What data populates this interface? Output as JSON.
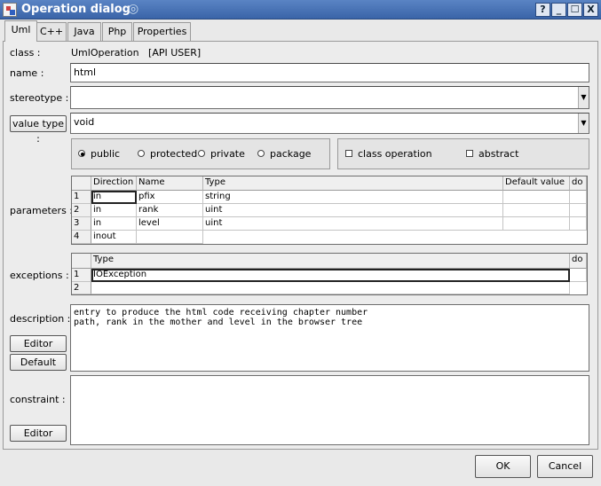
{
  "window": {
    "title": "Operation dialog",
    "help": "?",
    "minimize": "_",
    "maximize": "☐",
    "close": "X"
  },
  "tabs": [
    "Uml",
    "C++",
    "Java",
    "Php",
    "Properties"
  ],
  "class_row": {
    "label": "class :",
    "value": "UmlOperation   [API USER]"
  },
  "name_row": {
    "label": "name :",
    "value": "html"
  },
  "stereotype_row": {
    "label": "stereotype :",
    "value": ""
  },
  "value_type_row": {
    "button": "value type :",
    "value": "void"
  },
  "visibility": {
    "options": [
      "public",
      "protected",
      "private",
      "package"
    ],
    "selected": "public"
  },
  "flags": {
    "class_operation": "class operation",
    "abstract": "abstract",
    "class_operation_checked": false,
    "abstract_checked": false
  },
  "parameters": {
    "label": "parameters :",
    "columns": [
      "Direction",
      "Name",
      "Type",
      "Default value",
      "do"
    ],
    "rows": [
      {
        "num": "1",
        "direction": "in",
        "name": "pfix",
        "type": "string",
        "default": "",
        "do": ""
      },
      {
        "num": "2",
        "direction": "in",
        "name": "rank",
        "type": "uint",
        "default": "",
        "do": ""
      },
      {
        "num": "3",
        "direction": "in",
        "name": "level",
        "type": "uint",
        "default": "",
        "do": ""
      },
      {
        "num": "4",
        "direction": "inout",
        "name": "",
        "type": "",
        "default": "",
        "do": ""
      }
    ]
  },
  "exceptions": {
    "label": "exceptions :",
    "columns": [
      "Type",
      "do"
    ],
    "rows": [
      {
        "num": "1",
        "type": "IOException",
        "do": ""
      },
      {
        "num": "2",
        "type": "",
        "do": ""
      }
    ]
  },
  "description": {
    "label": "description :",
    "text": "entry to produce the html code receiving chapter number\npath, rank in the mother and level in the browser tree",
    "editor_button": "Editor",
    "default_button": "Default"
  },
  "constraint": {
    "label": "constraint :",
    "text": "",
    "editor_button": "Editor"
  },
  "footer": {
    "ok": "OK",
    "cancel": "Cancel"
  }
}
